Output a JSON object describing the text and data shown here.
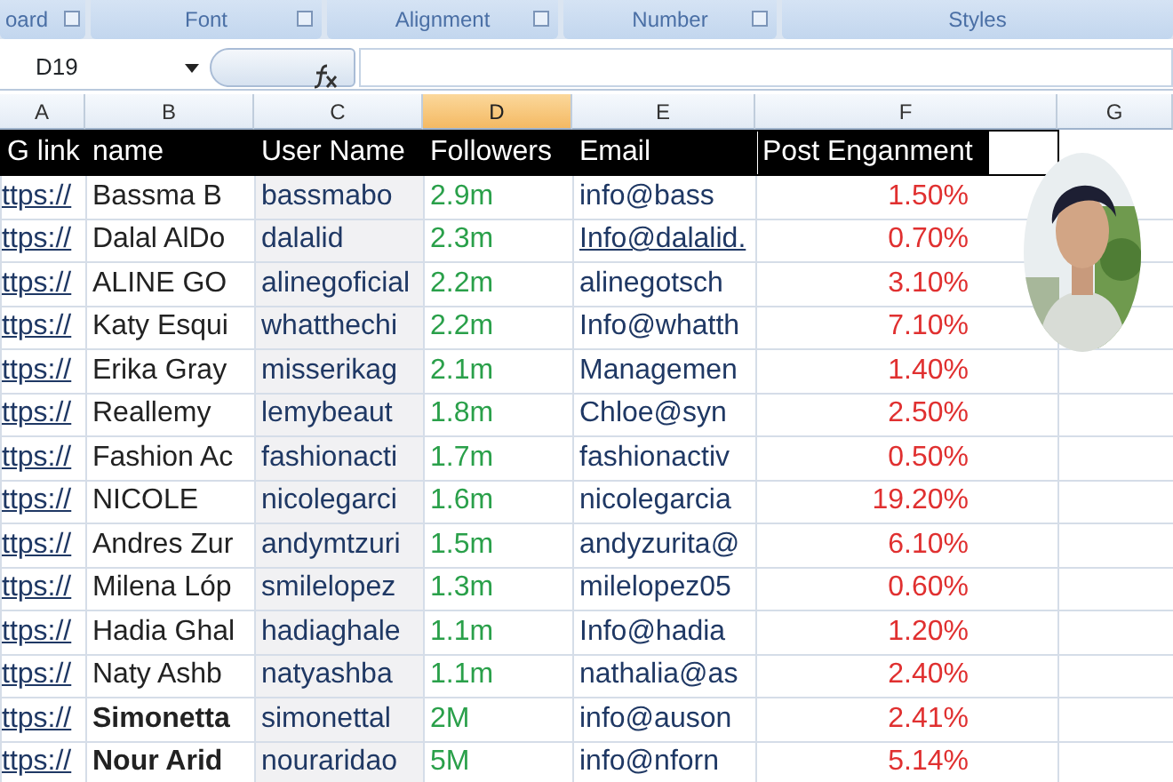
{
  "ribbon": {
    "groups": [
      {
        "label": "oard",
        "launcher": true
      },
      {
        "label": "Font",
        "launcher": true
      },
      {
        "label": "Alignment",
        "launcher": true
      },
      {
        "label": "Number",
        "launcher": true
      },
      {
        "label": "Styles",
        "launcher": false
      }
    ]
  },
  "formula_bar": {
    "name_box": "D19"
  },
  "columns": [
    {
      "letter": "A",
      "selected": false
    },
    {
      "letter": "B",
      "selected": false
    },
    {
      "letter": "C",
      "selected": false
    },
    {
      "letter": "D",
      "selected": true
    },
    {
      "letter": "E",
      "selected": false
    },
    {
      "letter": "F",
      "selected": false
    },
    {
      "letter": "G",
      "selected": false
    }
  ],
  "header_row": [
    "G link",
    "name",
    "User Name",
    "Followers",
    "Email",
    "Post Enganment"
  ],
  "rows": [
    {
      "link": "ttps://",
      "name": "Bassma B",
      "name_bold": false,
      "username": "bassmabo",
      "followers": "2.9m",
      "email": "info@bass",
      "email_link": false,
      "engagement": "1.50%"
    },
    {
      "link": "ttps://",
      "name": "Dalal AlDo",
      "name_bold": false,
      "username": "dalalid",
      "followers": "2.3m",
      "email": "Info@dalalid.",
      "email_link": true,
      "engagement": "0.70%"
    },
    {
      "link": "ttps://",
      "name": "ALINE GO",
      "name_bold": false,
      "username": "alinegoficial",
      "followers": "2.2m",
      "email": "alinegotsch",
      "email_link": false,
      "engagement": "3.10%"
    },
    {
      "link": "ttps://",
      "name": "Katy Esqui",
      "name_bold": false,
      "username": "whatthechi",
      "followers": "2.2m",
      "email": "Info@whatth",
      "email_link": false,
      "engagement": "7.10%"
    },
    {
      "link": "ttps://",
      "name": "Erika Gray",
      "name_bold": false,
      "username": "misserikag",
      "followers": "2.1m",
      "email": "Managemen",
      "email_link": false,
      "engagement": "1.40%"
    },
    {
      "link": "ttps://",
      "name": "Reallemy",
      "name_bold": false,
      "username": "lemybeaut",
      "followers": "1.8m",
      "email": "Chloe@syn",
      "email_link": false,
      "engagement": "2.50%"
    },
    {
      "link": "ttps://",
      "name": "Fashion Ac",
      "name_bold": false,
      "username": "fashionacti",
      "followers": "1.7m",
      "email": "fashionactiv",
      "email_link": false,
      "engagement": "0.50%"
    },
    {
      "link": "ttps://",
      "name": "NICOLE",
      "name_bold": false,
      "username": "nicolegarci",
      "followers": "1.6m",
      "email": "nicolegarcia",
      "email_link": false,
      "engagement": "19.20%"
    },
    {
      "link": "ttps://",
      "name": "Andres Zur",
      "name_bold": false,
      "username": "andymtzuri",
      "followers": "1.5m",
      "email": "andyzurita@",
      "email_link": false,
      "engagement": "6.10%"
    },
    {
      "link": "ttps://",
      "name": "Milena Lóp",
      "name_bold": false,
      "username": "smilelopez",
      "followers": "1.3m",
      "email": "milelopez05",
      "email_link": false,
      "engagement": "0.60%"
    },
    {
      "link": "ttps://",
      "name": "Hadia Ghal",
      "name_bold": false,
      "username": "hadiaghale",
      "followers": "1.1m",
      "email": "Info@hadia",
      "email_link": false,
      "engagement": "1.20%"
    },
    {
      "link": "ttps://",
      "name": "Naty Ashb",
      "name_bold": false,
      "username": "natyashba",
      "followers": "1.1m",
      "email": "nathalia@as",
      "email_link": false,
      "engagement": "2.40%"
    },
    {
      "link": "ttps://",
      "name": "Simonetta",
      "name_bold": true,
      "username": "simonettal",
      "followers": "2M",
      "email": "info@auson",
      "email_link": false,
      "engagement": "2.41%"
    },
    {
      "link": "ttps://",
      "name": "Nour Arid",
      "name_bold": true,
      "username": "nouraridao",
      "followers": "5M",
      "email": "info@nforn",
      "email_link": false,
      "engagement": "5.14%"
    }
  ],
  "picture": {
    "kind": "picture"
  }
}
